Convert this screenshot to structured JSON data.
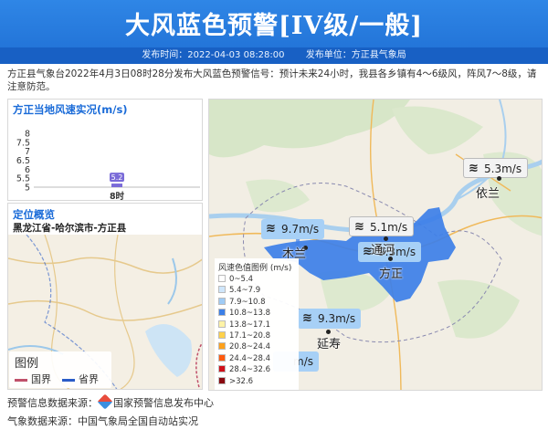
{
  "header": {
    "title": "大风蓝色预警[IV级/一般]",
    "issue_time": "发布时间：2022-04-03 08:28:00",
    "issuer": "发布单位：方正县气象局"
  },
  "notice": "方正县气象台2022年4月3日08时28分发布大风蓝色预警信号：预计未来24小时，我县各乡镇有4～6级风，阵风7～8级，请注意防范。",
  "wind_panel": {
    "title": "方正当地风速实况(m/s)"
  },
  "chart_data": {
    "type": "bar",
    "categories": [
      "8时"
    ],
    "values": [
      5.2
    ],
    "data_labels": [
      "5.2"
    ],
    "yticks": [
      "8",
      "7.5",
      "7",
      "6.5",
      "6",
      "5.5",
      "5"
    ],
    "ylim": [
      5,
      8
    ],
    "title": "方正当地风速实况(m/s)",
    "xlabel": "",
    "ylabel": "",
    "bar_color": "#7a6bd8"
  },
  "location": {
    "title": "定位概览",
    "path": "黑龙江省-哈尔滨市-方正县",
    "legend_title": "图例",
    "legend_items": [
      {
        "label": "国界",
        "color": "#c0506a"
      },
      {
        "label": "省界",
        "color": "#2a5cc8"
      }
    ]
  },
  "map": {
    "scale_title": "风速色值图例 (m/s)",
    "scale": [
      {
        "label": "0~5.4",
        "color": "#ffffff"
      },
      {
        "label": "5.4~7.9",
        "color": "#cfe6fb"
      },
      {
        "label": "7.9~10.8",
        "color": "#9fcbf5"
      },
      {
        "label": "10.8~13.8",
        "color": "#3b7fe6"
      },
      {
        "label": "13.8~17.1",
        "color": "#fff3a6"
      },
      {
        "label": "17.1~20.8",
        "color": "#ffd14a"
      },
      {
        "label": "20.8~24.4",
        "color": "#ffa11a"
      },
      {
        "label": "24.4~28.4",
        "color": "#ff5a0e"
      },
      {
        "label": "28.4~32.6",
        "color": "#d0101a"
      },
      {
        "label": ">32.6",
        "color": "#8a0a10"
      }
    ],
    "wind_labels": [
      {
        "value": "5.3m/s",
        "color": "#f3f3f3"
      },
      {
        "value": "9.7m/s",
        "color": "#a7d0f6"
      },
      {
        "value": "5.1m/s",
        "color": "#f3f3f3"
      },
      {
        "value": "9.3m/s",
        "color": "#a7d0f6"
      },
      {
        "value": "9.3m/s",
        "color": "#a7d0f6"
      },
      {
        "value": "m/s",
        "color": "#a7d0f6"
      }
    ],
    "places": [
      "依兰",
      "木兰",
      "通河",
      "方正",
      "延寿"
    ]
  },
  "footer": {
    "line1_label": "预警信息数据来源：",
    "line1_source": "国家预警信息发布中心",
    "line2": "气象数据来源：中国气象局全国自动站实况"
  }
}
